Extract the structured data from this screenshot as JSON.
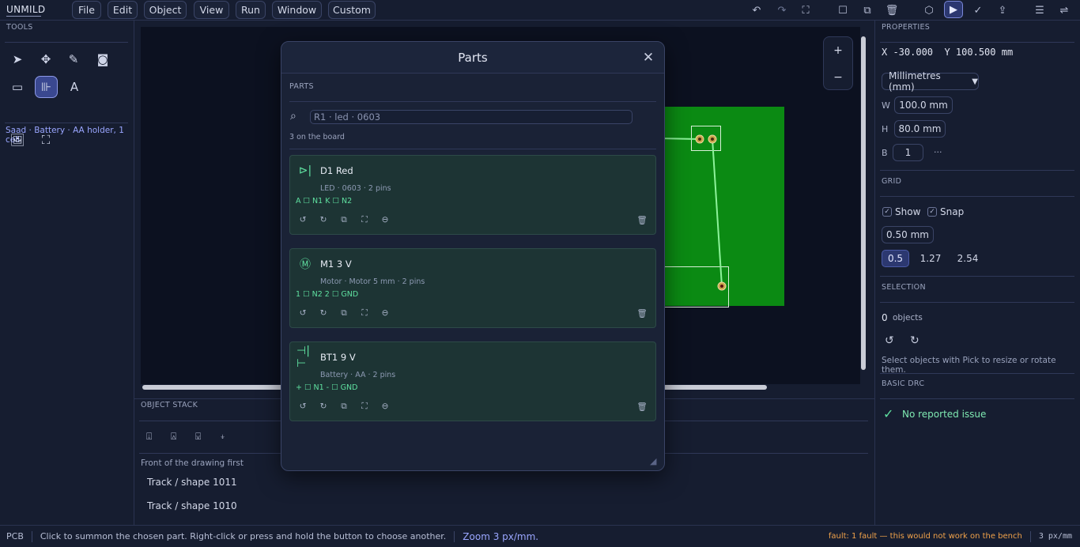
{
  "app": {
    "logo": "UNMILD"
  },
  "menu": [
    "File",
    "Edit",
    "Object",
    "View",
    "Run",
    "Window",
    "Custom"
  ],
  "toolbar": {
    "icons": [
      "undo-icon",
      "redo-icon",
      "fit-screen-icon",
      "square-icon",
      "group-icon",
      "trash-icon",
      "cube-icon",
      "run-play-icon",
      "check-icon",
      "export-icon",
      "hamburger-icon",
      "sliders-icon"
    ]
  },
  "tools": {
    "title": "TOOLS",
    "active_part": "Saad · Battery · AA holder, 1 cell"
  },
  "canvas": {},
  "zoom": {
    "plus": "+",
    "minus": "−"
  },
  "object_stack": {
    "title": "OBJECT STACK",
    "hint": "Front of the drawing first",
    "items": [
      "Track / shape 1011",
      "Track / shape 1010"
    ]
  },
  "properties": {
    "title": "PROPERTIES",
    "coords": "X -30.000  Y 100.500 mm",
    "unit": "Millimetres (mm)",
    "w_label": "W",
    "w": "100.0 mm",
    "h_label": "H",
    "h": "80.0 mm",
    "b_label": "B",
    "b": "1",
    "b_more": "···"
  },
  "grid": {
    "title": "GRID",
    "show": "Show",
    "snap": "Snap",
    "size": "0.50 mm",
    "presets": [
      "0.5",
      "1.27",
      "2.54"
    ],
    "selected_preset": "0.5"
  },
  "selection": {
    "title": "SELECTION",
    "count": "0",
    "count_label": "objects",
    "hint": "Select objects with Pick to resize or rotate them."
  },
  "drc": {
    "title": "BASIC DRC",
    "status": "No reported issue"
  },
  "statusbar": {
    "mode": "PCB",
    "hint": "Click to summon the chosen part. Right-click or press and hold the button to choose another.",
    "zoom": "Zoom 3 px/mm.",
    "fault": "fault: 1 fault — this would not work on the bench",
    "scale": "3 px/mm"
  },
  "dialog": {
    "title": "Parts",
    "section": "PARTS",
    "search_placeholder": "R1 · led · 0603",
    "count": "3 on the board",
    "cards": [
      {
        "icon": "led-icon",
        "name": "D1 Red",
        "desc": "LED · 0603 · 2 pins",
        "pins": "A ☐ N1   K ☐ N2"
      },
      {
        "icon": "motor-icon",
        "name": "M1 3 V",
        "desc": "Motor · Motor 5 mm · 2 pins",
        "pins": "1 ☐ N2   2 ☐ GND"
      },
      {
        "icon": "battery-icon",
        "name": "BT1 9 V",
        "desc": "Battery · AA · 2 pins",
        "pins": "+ ☐ N1   - ☐ GND"
      }
    ]
  },
  "colors": {
    "accent": "#7a88d8",
    "board_green": "#0b8a13",
    "ok_green": "#5fe0a0",
    "fault": "#f0a24a",
    "background": "#161d30"
  }
}
